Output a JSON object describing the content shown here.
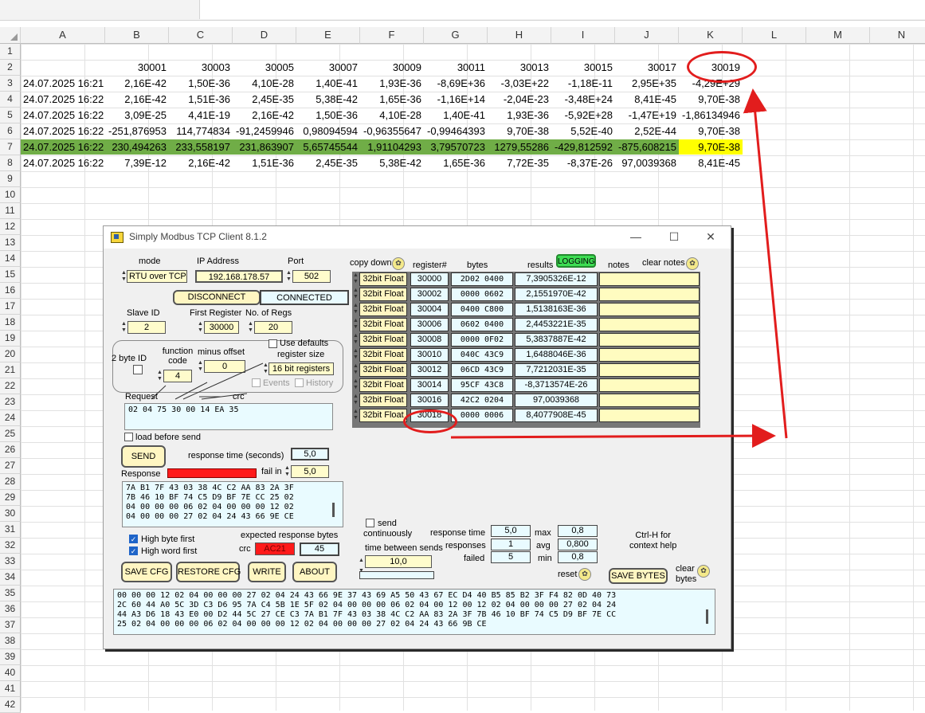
{
  "sheet": {
    "columns": [
      "A",
      "B",
      "C",
      "D",
      "E",
      "F",
      "G",
      "H",
      "I",
      "J",
      "K",
      "L",
      "M",
      "N"
    ],
    "row_numbers": [
      "1",
      "2",
      "3",
      "4",
      "5",
      "6",
      "7",
      "8",
      "9",
      "10",
      "11",
      "12",
      "13",
      "14",
      "15",
      "16",
      "17",
      "18",
      "19",
      "20",
      "21",
      "22",
      "23",
      "24",
      "25",
      "26",
      "27",
      "28",
      "29",
      "30",
      "31",
      "32",
      "33",
      "34",
      "35",
      "36",
      "37",
      "38",
      "39",
      "40",
      "41",
      "42"
    ],
    "rows": [
      [
        "",
        "30001",
        "30003",
        "30005",
        "30007",
        "30009",
        "30011",
        "30013",
        "30015",
        "30017",
        "30019"
      ],
      [
        "24.07.2025 16:21",
        "2,16E-42",
        "1,50E-36",
        "4,10E-28",
        "1,40E-41",
        "1,93E-36",
        "-8,69E+36",
        "-3,03E+22",
        "-1,18E-11",
        "2,95E+35",
        "-4,29E+29"
      ],
      [
        "24.07.2025 16:22",
        "2,16E-42",
        "1,51E-36",
        "2,45E-35",
        "5,38E-42",
        "1,65E-36",
        "-1,16E+14",
        "-2,04E-23",
        "-3,48E+24",
        "8,41E-45",
        "9,70E-38"
      ],
      [
        "24.07.2025 16:22",
        "3,09E-25",
        "4,41E-19",
        "2,16E-42",
        "1,50E-36",
        "4,10E-28",
        "1,40E-41",
        "1,93E-36",
        "-5,92E+28",
        "-1,47E+19",
        "-1,86134946"
      ],
      [
        "24.07.2025 16:22",
        "-251,876953",
        "114,774834",
        "-91,2459946",
        "0,98094594",
        "-0,96355647",
        "-0,99464393",
        "9,70E-38",
        "5,52E-40",
        "2,52E-44",
        "9,70E-38"
      ],
      [
        "24.07.2025 16:22",
        "230,494263",
        "233,558197",
        "231,863907",
        "5,65745544",
        "1,91104293",
        "3,79570723",
        "1279,55286",
        "-429,812592",
        "-875,608215",
        "9,70E-38"
      ],
      [
        "24.07.2025 16:22",
        "7,39E-12",
        "2,16E-42",
        "1,51E-36",
        "2,45E-35",
        "5,38E-42",
        "1,65E-36",
        "7,72E-35",
        "-8,37E-26",
        "97,0039368",
        "8,41E-45"
      ]
    ],
    "highlight_colors": {
      "row_green": "#70ad47",
      "cell_yellow": "#ffff00"
    }
  },
  "window": {
    "title": "Simply Modbus TCP Client 8.1.2",
    "controls": {
      "minimize": "—",
      "maximize": "☐",
      "close": "✕"
    },
    "mode_label": "mode",
    "mode_value": "RTU over TCP",
    "ip_label": "IP Address",
    "ip_value": "192.168.178.57",
    "port_label": "Port",
    "port_value": "502",
    "disconnect_button": "DISCONNECT",
    "connected_status": "CONNECTED",
    "slave_id_label": "Slave ID",
    "slave_id_value": "2",
    "first_register_label": "First Register",
    "first_register_value": "30000",
    "no_regs_label": "No. of Regs",
    "no_regs_value": "20",
    "use_defaults_label": "Use defaults",
    "register_size_label": "register size",
    "register_size_value": "16 bit registers",
    "two_byte_id_label": "2 byte ID",
    "function_code_label": "function code",
    "function_code_value": "4",
    "minus_offset_label": "minus offset",
    "minus_offset_value": "0",
    "events_label": "Events",
    "history_label": "History",
    "request_label": "Request",
    "crc_label_top": "crc",
    "request_value": "02 04 75 30 00 14 EA 35",
    "load_before_send_label": "load before send",
    "send_button": "SEND",
    "response_time_label": "response time (seconds)",
    "response_time_value": "5,0",
    "response_label": "Response",
    "fail_in_label": "fail in",
    "fail_in_value": "5,0",
    "response_value": "7A B1 7F 43 03 38 4C C2 AA 83 2A 3F\n7B 46 10 BF 74 C5 D9 BF 7E CC 25 02\n04 00 00 00 06 02 04 00 00 00 12 02\n04 00 00 00 27 02 04 24 43 66 9E CE",
    "high_byte_first_label": "High byte first",
    "high_word_first_label": "High word first",
    "expected_bytes_label": "expected response bytes",
    "crc_label": "crc",
    "crc_value": "AC21",
    "expected_bytes_value": "45",
    "buttons": {
      "save_cfg": "SAVE CFG",
      "restore_cfg": "RESTORE CFG",
      "write": "WRITE",
      "about": "ABOUT"
    },
    "copy_down_label": "copy down",
    "col_register": "register#",
    "col_bytes": "bytes",
    "col_results": "results",
    "logging_badge": "LOGGING",
    "col_notes": "notes",
    "clear_notes_label": "clear notes",
    "table": [
      {
        "type": "32bit Float",
        "reg": "30000",
        "bytes": "2D02 0400",
        "result": "7,3905326E-12"
      },
      {
        "type": "32bit Float",
        "reg": "30002",
        "bytes": "0000 0602",
        "result": "2,1551970E-42"
      },
      {
        "type": "32bit Float",
        "reg": "30004",
        "bytes": "0400 C800",
        "result": "1,5138163E-36"
      },
      {
        "type": "32bit Float",
        "reg": "30006",
        "bytes": "0602 0400",
        "result": "2,4453221E-35"
      },
      {
        "type": "32bit Float",
        "reg": "30008",
        "bytes": "0000 0F02",
        "result": "5,3837887E-42"
      },
      {
        "type": "32bit Float",
        "reg": "30010",
        "bytes": "040C 43C9",
        "result": "1,6488046E-36"
      },
      {
        "type": "32bit Float",
        "reg": "30012",
        "bytes": "06CD 43C9",
        "result": "7,7212031E-35"
      },
      {
        "type": "32bit Float",
        "reg": "30014",
        "bytes": "95CF 43C8",
        "result": "-8,3713574E-26"
      },
      {
        "type": "32bit Float",
        "reg": "30016",
        "bytes": "42C2 0204",
        "result": "97,0039368"
      },
      {
        "type": "32bit Float",
        "reg": "30018",
        "bytes": "0000 0006",
        "result": "8,4077908E-45"
      }
    ],
    "send_continuously_label": "send continuously",
    "time_between_sends_label": "time between sends",
    "time_between_sends_value": "10,0",
    "stats": {
      "response_time_label": "response time",
      "response_time_value": "5,0",
      "responses_label": "responses",
      "responses_value": "1",
      "failed_label": "failed",
      "failed_value": "5",
      "max_label": "max",
      "max_value": "0,8",
      "avg_label": "avg",
      "avg_value": "0,800",
      "min_label": "min",
      "min_value": "0,8"
    },
    "reset_label": "reset",
    "context_help": "Ctrl-H for\ncontext help",
    "save_bytes_button": "SAVE BYTES",
    "clear_bytes_label": "clear\nbytes",
    "bytes_log": "00 00 00 12 02 04 00 00 00 27 02 04 24 43 66 9E 37 43 69 A5 50 43 67 EC D4 40 B5 85 B2 3F F4 82 0D 40 73\n2C 60 44 A0 5C 3D C3 D6 95 7A C4 5B 1E 5F 02 04 00 00 00 06 02 04 00 12 00 12 02 04 00 00 00 27 02 04 24\n44 A3 D6 18 43 E0 00 D2 44 5C 27 CE C3 7A B1 7F 43 03 38 4C C2 AA 83 2A 3F 7B 46 10 BF 74 C5 D9 BF 7E CC\n25 02 04 00 00 00 06 02 04 00 00 00 12 02 04 00 00 00 27 02 04 24 43 66 9B CE"
  },
  "annotation_color": "#e21d1d"
}
